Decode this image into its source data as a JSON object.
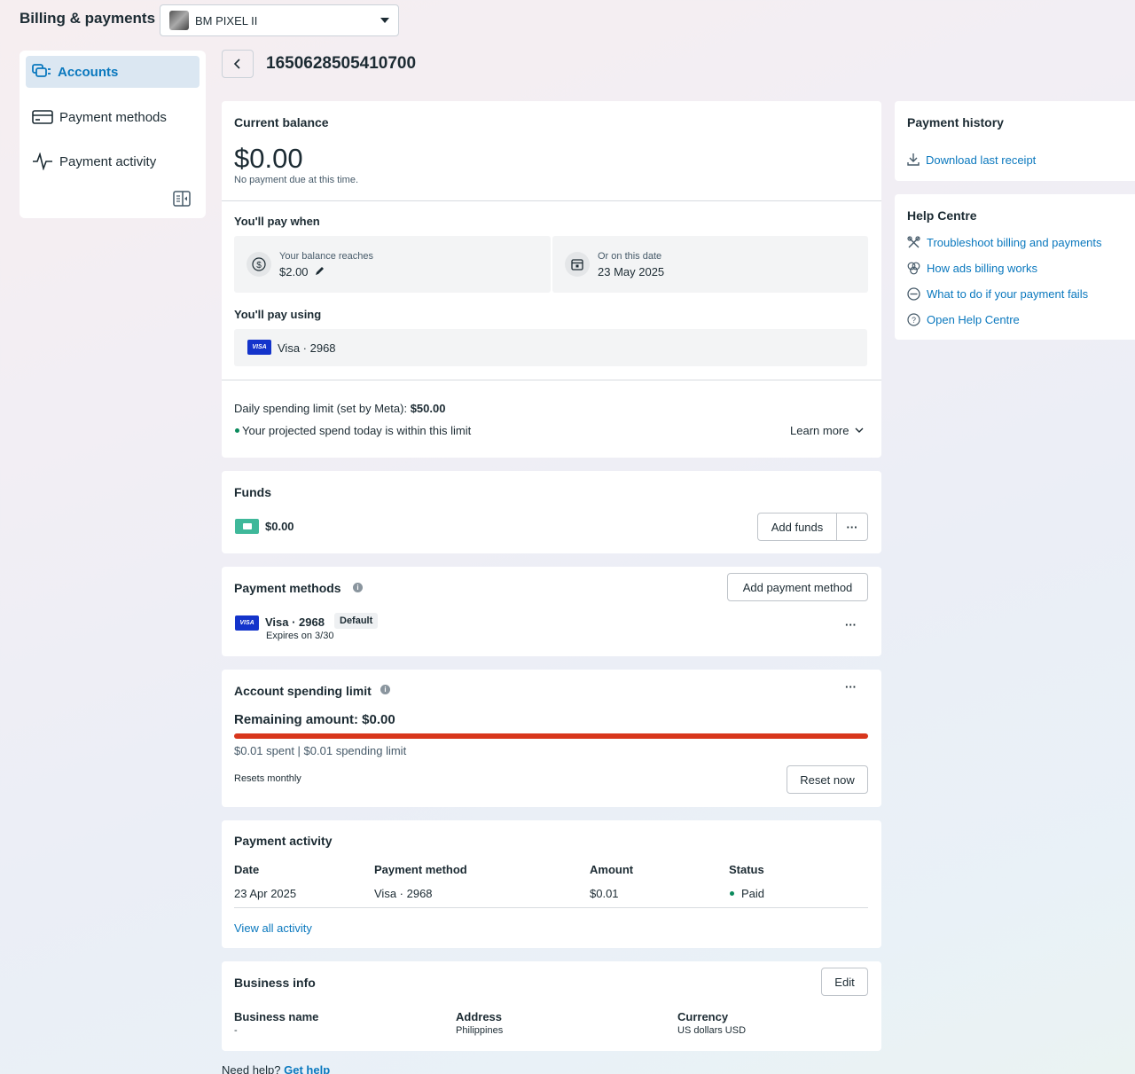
{
  "header": {
    "title": "Billing & payments",
    "business_manager": "BM PIXEL II"
  },
  "sidebar": {
    "items": [
      {
        "label": "Accounts",
        "icon": "accounts-icon",
        "active": true
      },
      {
        "label": "Payment methods",
        "icon": "card-icon",
        "active": false
      },
      {
        "label": "Payment activity",
        "icon": "activity-icon",
        "active": false
      }
    ]
  },
  "account": {
    "id": "1650628505410700"
  },
  "balance": {
    "heading": "Current balance",
    "amount": "$0.00",
    "note": "No payment due at this time.",
    "pay_when_heading": "You'll pay when",
    "threshold_label": "Your balance reaches",
    "threshold_value": "$2.00",
    "date_label": "Or on this date",
    "date_value": "23 May 2025",
    "pay_using_heading": "You'll pay using",
    "pay_using_card": "Visa · 2968",
    "daily_limit_label": "Daily spending limit (set by Meta): ",
    "daily_limit_value": "$50.00",
    "projected_note": "Your projected spend today is within this limit",
    "learn_more": "Learn more"
  },
  "funds": {
    "heading": "Funds",
    "amount": "$0.00",
    "add_funds": "Add funds",
    "more": "···"
  },
  "payment_methods": {
    "heading": "Payment methods",
    "add_button": "Add payment method",
    "card": "Visa · 2968",
    "badge": "Default",
    "expires": "Expires on 3/30",
    "more": "···"
  },
  "spending_limit": {
    "heading": "Account spending limit",
    "remaining": "Remaining amount: $0.00",
    "progress_fraction": 1.0,
    "detail": "$0.01 spent | $0.01 spending limit",
    "resets": "Resets monthly",
    "reset_button": "Reset now",
    "more": "···",
    "bar_color": "#d8361c"
  },
  "activity": {
    "heading": "Payment activity",
    "columns": [
      "Date",
      "Payment method",
      "Amount",
      "Status"
    ],
    "rows": [
      {
        "date": "23 Apr 2025",
        "method": "Visa · 2968",
        "amount": "$0.01",
        "status": "Paid"
      }
    ],
    "view_all": "View all activity"
  },
  "business_info": {
    "heading": "Business info",
    "edit": "Edit",
    "fields": [
      {
        "label": "Business name",
        "value": "-"
      },
      {
        "label": "Address",
        "value": "Philippines"
      },
      {
        "label": "Currency",
        "value": "US dollars USD"
      }
    ]
  },
  "footer": {
    "need_help": "Need help?",
    "get_help": "Get help"
  },
  "payment_history": {
    "heading": "Payment history",
    "download": "Download last receipt"
  },
  "help_centre": {
    "heading": "Help Centre",
    "links": [
      {
        "label": "Troubleshoot billing and payments",
        "icon": "tools-icon"
      },
      {
        "label": "How ads billing works",
        "icon": "circles-icon"
      },
      {
        "label": "What to do if your payment fails",
        "icon": "minus-circle-icon"
      },
      {
        "label": "Open Help Centre",
        "icon": "question-icon"
      }
    ]
  },
  "colors": {
    "accent": "#0a78be",
    "active_bg": "#dbe7f2",
    "success_dot": "#0a8a5c",
    "visa_blue": "#1434cb",
    "wallet_green": "#3fb89a"
  }
}
